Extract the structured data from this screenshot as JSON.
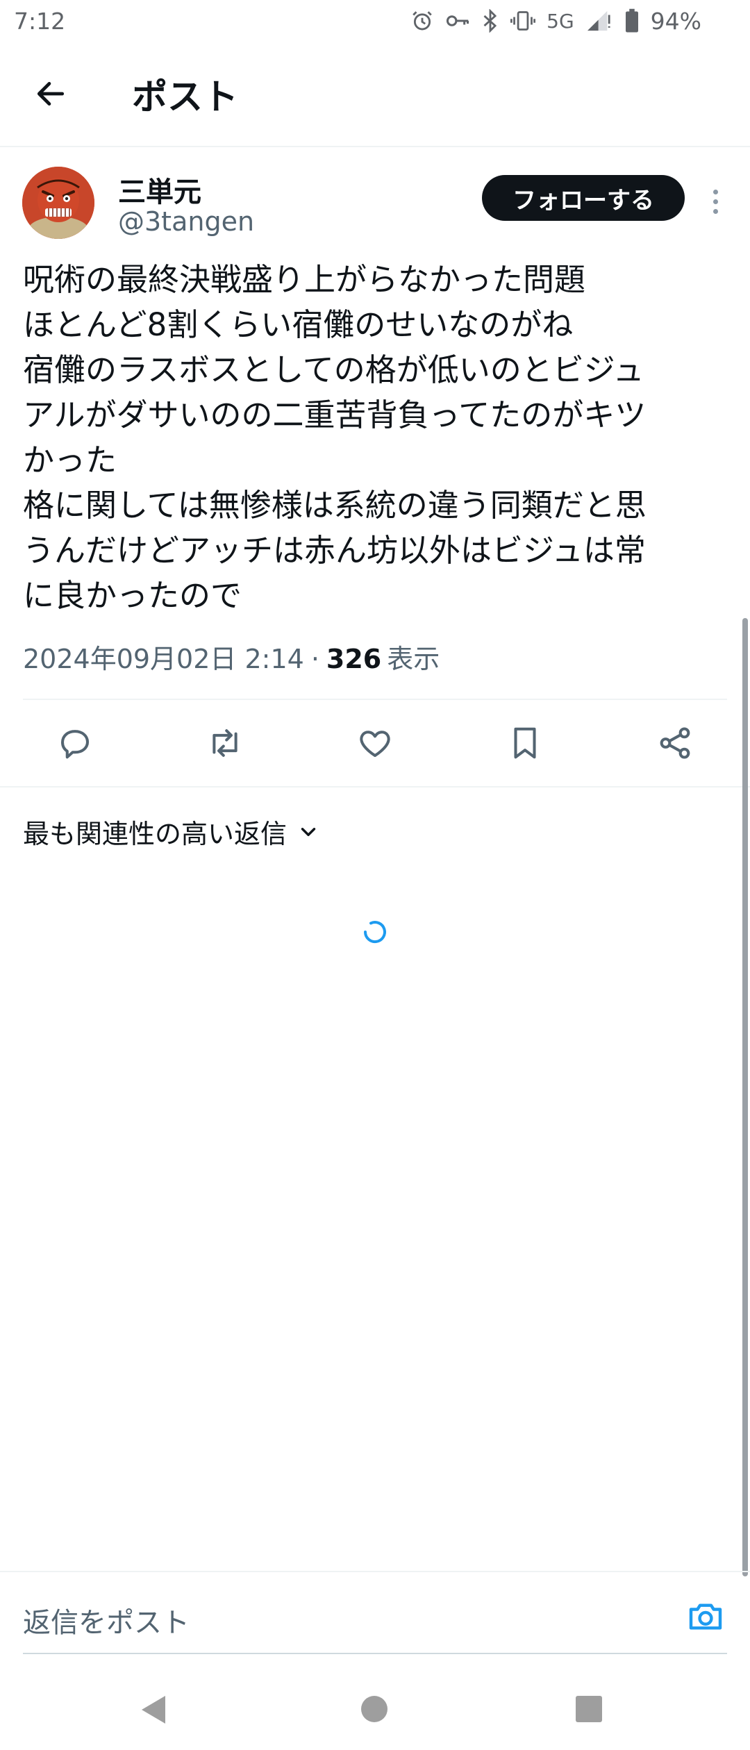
{
  "status_bar": {
    "time": "7:12",
    "network": "5G",
    "battery": "94%",
    "icons": [
      "alarm-icon",
      "vpn-key-icon",
      "bluetooth-icon",
      "vibrate-icon",
      "signal-icon",
      "battery-icon"
    ]
  },
  "header": {
    "title": "ポスト",
    "back_icon": "arrow-left-icon"
  },
  "author": {
    "name": "三単元",
    "handle": "@3tangen",
    "follow_label": "フォローする"
  },
  "post": {
    "lines": [
      "呪術の最終決戦盛り上がらなかった問題",
      "ほとんど8割くらい宿儺のせいなのがね",
      "宿儺のラスボスとしての格が低いのとビジュ",
      "アルがダサいのの二重苦背負ってたのがキツ",
      "かった",
      "格に関しては無惨様は系統の違う同類だと思",
      "うんだけどアッチは赤ん坊以外はビジュは常",
      "に良かったので"
    ],
    "timestamp": "2024年09月02日 2:14",
    "separator": "·",
    "views_count": "326",
    "views_label": "表示"
  },
  "actions": {
    "icons": [
      "reply-icon",
      "repost-icon",
      "like-icon",
      "bookmark-icon",
      "share-icon"
    ]
  },
  "replies": {
    "sort_label": "最も関連性の高い返信"
  },
  "composer": {
    "placeholder": "返信をポスト"
  },
  "colors": {
    "text_primary": "#0f1419",
    "text_secondary": "#536471",
    "accent": "#1d9bf0",
    "follow_bg": "#0f1419",
    "divider": "#eff3f4"
  }
}
